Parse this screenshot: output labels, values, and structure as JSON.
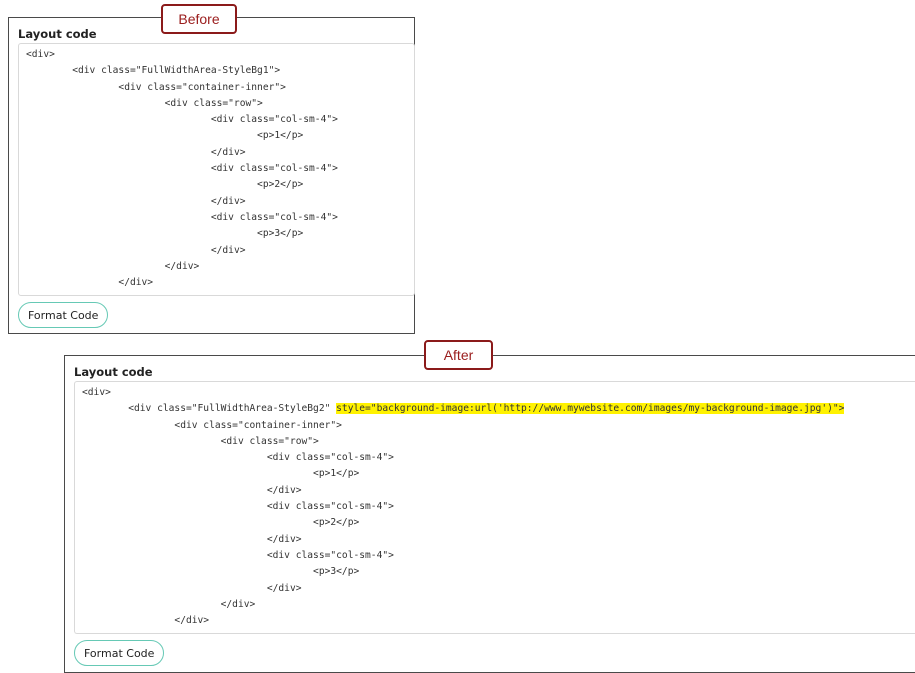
{
  "before": {
    "tag": "Before",
    "title": "Layout code",
    "code_lines": [
      {
        "text": "<div>"
      },
      {
        "text": "\t<div class=\"FullWidthArea-StyleBg1\">"
      },
      {
        "text": "\t\t<div class=\"container-inner\">"
      },
      {
        "text": "\t\t\t<div class=\"row\">"
      },
      {
        "text": "\t\t\t\t<div class=\"col-sm-4\">"
      },
      {
        "text": "\t\t\t\t\t<p>1</p>"
      },
      {
        "text": "\t\t\t\t</div>"
      },
      {
        "text": "\t\t\t\t<div class=\"col-sm-4\">"
      },
      {
        "text": "\t\t\t\t\t<p>2</p>"
      },
      {
        "text": "\t\t\t\t</div>"
      },
      {
        "text": "\t\t\t\t<div class=\"col-sm-4\">"
      },
      {
        "text": "\t\t\t\t\t<p>3</p>"
      },
      {
        "text": "\t\t\t\t</div>"
      },
      {
        "text": "\t\t\t</div>"
      },
      {
        "text": "\t\t</div>"
      }
    ],
    "button": "Format Code"
  },
  "after": {
    "tag": "After",
    "title": "Layout code",
    "code_lines": [
      {
        "text": "<div>"
      },
      {
        "text": "\t<div class=\"FullWidthArea-StyleBg2\" ",
        "highlight": "style=\"background-image:url('http://www.mywebsite.com/images/my-background-image.jpg')\">"
      },
      {
        "text": "\t\t<div class=\"container-inner\">"
      },
      {
        "text": "\t\t\t<div class=\"row\">"
      },
      {
        "text": "\t\t\t\t<div class=\"col-sm-4\">"
      },
      {
        "text": "\t\t\t\t\t<p>1</p>"
      },
      {
        "text": "\t\t\t\t</div>"
      },
      {
        "text": "\t\t\t\t<div class=\"col-sm-4\">"
      },
      {
        "text": "\t\t\t\t\t<p>2</p>"
      },
      {
        "text": "\t\t\t\t</div>"
      },
      {
        "text": "\t\t\t\t<div class=\"col-sm-4\">"
      },
      {
        "text": "\t\t\t\t\t<p>3</p>"
      },
      {
        "text": "\t\t\t\t</div>"
      },
      {
        "text": "\t\t\t</div>"
      },
      {
        "text": "\t\t</div>"
      }
    ],
    "button": "Format Code"
  },
  "colors": {
    "tag_border": "#8b1a1a",
    "highlight": "#fff200",
    "button_border": "#66c9b5"
  }
}
